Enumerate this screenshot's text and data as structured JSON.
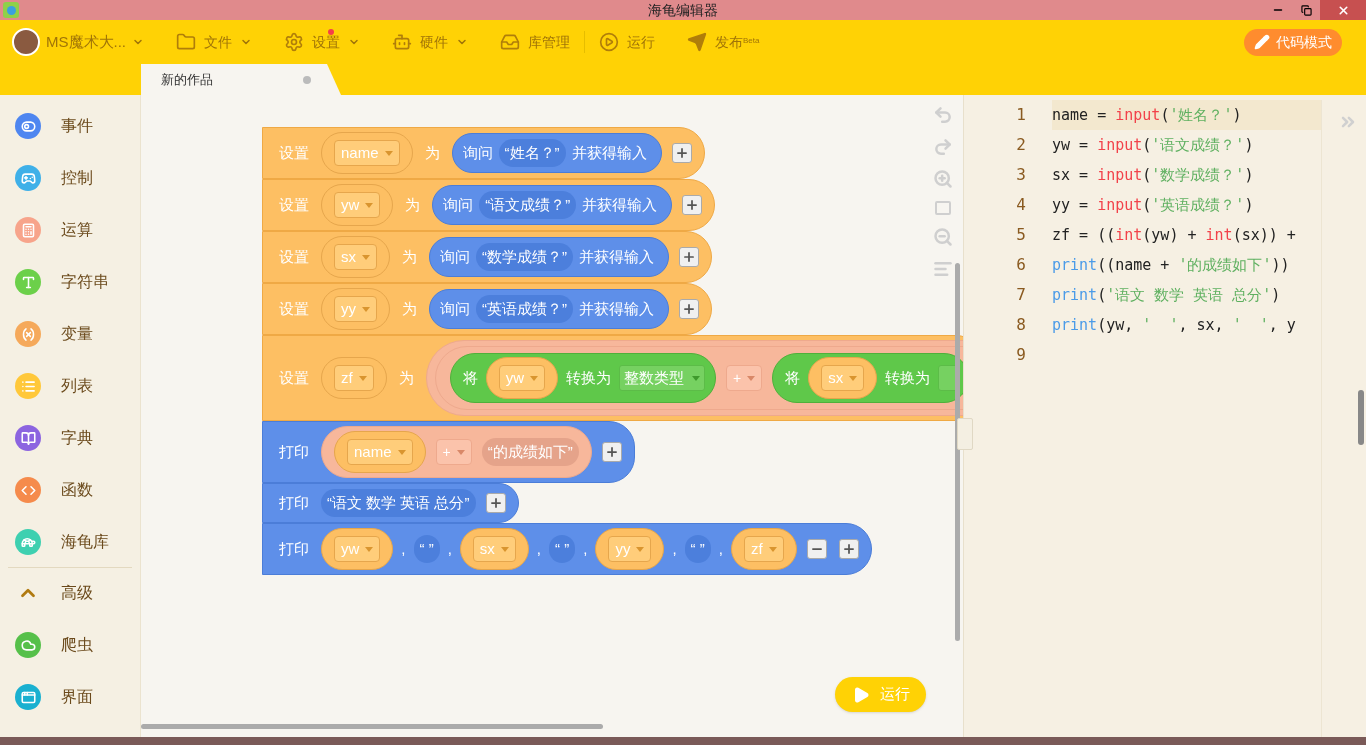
{
  "window": {
    "title": "海龟编辑器"
  },
  "toolbar": {
    "user": {
      "name": "MS魔术大..."
    },
    "menus": [
      {
        "label": "文件",
        "kind": "dropdown",
        "badge": false
      },
      {
        "label": "设置",
        "kind": "dropdown",
        "badge": true
      },
      {
        "label": "硬件",
        "kind": "dropdown",
        "badge": false
      },
      {
        "label": "库管理",
        "kind": "plain",
        "badge": false
      },
      {
        "label": "运行",
        "kind": "plain",
        "badge": false
      },
      {
        "label": "发布",
        "kind": "plain",
        "badge": false,
        "sup": "Beta"
      }
    ],
    "mode_button": "代码模式"
  },
  "tabs": [
    {
      "label": "新的作品",
      "selected": true
    }
  ],
  "sidebar": {
    "items": [
      {
        "label": "事件",
        "kind": "category",
        "color": "#4e86f0"
      },
      {
        "label": "控制",
        "kind": "category",
        "color": "#3fb0e8"
      },
      {
        "label": "运算",
        "kind": "category",
        "color": "#f7a48b"
      },
      {
        "label": "字符串",
        "kind": "category",
        "color": "#6cd04a"
      },
      {
        "label": "变量",
        "kind": "category",
        "color": "#f5a95b"
      },
      {
        "label": "列表",
        "kind": "category",
        "color": "#ffc83a"
      },
      {
        "label": "字典",
        "kind": "category",
        "color": "#8c64e0"
      },
      {
        "label": "函数",
        "kind": "category",
        "color": "#f58b4c"
      },
      {
        "label": "海龟库",
        "kind": "category",
        "color": "#3ed0b0"
      },
      {
        "label": "高级",
        "kind": "section",
        "color": "#b07a10"
      },
      {
        "label": "爬虫",
        "kind": "category",
        "color": "#56c04a"
      },
      {
        "label": "界面",
        "kind": "category",
        "color": "#1ab0d0"
      }
    ]
  },
  "blocks": [
    {
      "kind": "set",
      "parts": [
        {
          "kind": "label",
          "text": "设置"
        },
        {
          "kind": "var",
          "text": "name"
        },
        {
          "kind": "label",
          "text": "为"
        },
        {
          "kind": "ask",
          "label": "询问",
          "prompt": "“姓名？”",
          "suffix": "并获得输入"
        },
        {
          "kind": "plus"
        }
      ]
    },
    {
      "kind": "set",
      "parts": [
        {
          "kind": "label",
          "text": "设置"
        },
        {
          "kind": "var",
          "text": "yw"
        },
        {
          "kind": "label",
          "text": "为"
        },
        {
          "kind": "ask",
          "label": "询问",
          "prompt": "“语文成绩？”",
          "suffix": "并获得输入"
        },
        {
          "kind": "plus"
        }
      ]
    },
    {
      "kind": "set",
      "parts": [
        {
          "kind": "label",
          "text": "设置"
        },
        {
          "kind": "var",
          "text": "sx"
        },
        {
          "kind": "label",
          "text": "为"
        },
        {
          "kind": "ask",
          "label": "询问",
          "prompt": "“数学成绩？”",
          "suffix": "并获得输入"
        },
        {
          "kind": "plus"
        }
      ]
    },
    {
      "kind": "set",
      "parts": [
        {
          "kind": "label",
          "text": "设置"
        },
        {
          "kind": "var",
          "text": "yy"
        },
        {
          "kind": "label",
          "text": "为"
        },
        {
          "kind": "ask",
          "label": "询问",
          "prompt": "“英语成绩？”",
          "suffix": "并获得输入"
        },
        {
          "kind": "plus"
        }
      ]
    },
    {
      "kind": "set",
      "parts": [
        {
          "kind": "label",
          "text": "设置"
        },
        {
          "kind": "var",
          "text": "zf"
        },
        {
          "kind": "label",
          "text": "为"
        },
        {
          "kind": "expr",
          "nested": true,
          "parts": [
            {
              "kind": "convert",
              "label": "将",
              "var": "yw",
              "to": "转换为",
              "type": "整数类型"
            },
            {
              "kind": "op",
              "text": "+"
            },
            {
              "kind": "convert",
              "label": "将",
              "var": "sx",
              "to": "转换为"
            }
          ]
        }
      ]
    },
    {
      "kind": "print",
      "parts": [
        {
          "kind": "label",
          "text": "打印"
        },
        {
          "kind": "expr",
          "nested": false,
          "parts": [
            {
              "kind": "var",
              "text": "name"
            },
            {
              "kind": "op",
              "text": "+"
            },
            {
              "kind": "string",
              "text": "“的成绩如下”"
            }
          ]
        },
        {
          "kind": "plus"
        }
      ]
    },
    {
      "kind": "print",
      "parts": [
        {
          "kind": "label",
          "text": "打印"
        },
        {
          "kind": "string",
          "text": "“语文 数学 英语 总分”"
        },
        {
          "kind": "plus"
        }
      ]
    },
    {
      "kind": "print",
      "parts": [
        {
          "kind": "label",
          "text": "打印"
        },
        {
          "kind": "var",
          "text": "yw"
        },
        {
          "kind": "sep",
          "text": ","
        },
        {
          "kind": "string",
          "text": "“ ”"
        },
        {
          "kind": "sep",
          "text": ","
        },
        {
          "kind": "var",
          "text": "sx"
        },
        {
          "kind": "sep",
          "text": ","
        },
        {
          "kind": "string",
          "text": "“ ”"
        },
        {
          "kind": "sep",
          "text": ","
        },
        {
          "kind": "var",
          "text": "yy"
        },
        {
          "kind": "sep",
          "text": ","
        },
        {
          "kind": "string",
          "text": "“ ”"
        },
        {
          "kind": "sep",
          "text": ","
        },
        {
          "kind": "var",
          "text": "zf"
        },
        {
          "kind": "minus"
        },
        {
          "kind": "plus"
        }
      ]
    }
  ],
  "run_button": "运行",
  "code": {
    "lines": [
      {
        "number": "1",
        "highlighted": true,
        "tokens": [
          {
            "kind": "name",
            "text": "name = "
          },
          {
            "kind": "builtin",
            "text": "input"
          },
          {
            "kind": "name",
            "text": "("
          },
          {
            "kind": "string",
            "text": "'姓名？'"
          },
          {
            "kind": "name",
            "text": ")"
          }
        ]
      },
      {
        "number": "2",
        "highlighted": false,
        "tokens": [
          {
            "kind": "name",
            "text": "yw = "
          },
          {
            "kind": "builtin",
            "text": "input"
          },
          {
            "kind": "name",
            "text": "("
          },
          {
            "kind": "string",
            "text": "'语文成绩？'"
          },
          {
            "kind": "name",
            "text": ")"
          }
        ]
      },
      {
        "number": "3",
        "highlighted": false,
        "tokens": [
          {
            "kind": "name",
            "text": "sx = "
          },
          {
            "kind": "builtin",
            "text": "input"
          },
          {
            "kind": "name",
            "text": "("
          },
          {
            "kind": "string",
            "text": "'数学成绩？'"
          },
          {
            "kind": "name",
            "text": ")"
          }
        ]
      },
      {
        "number": "4",
        "highlighted": false,
        "tokens": [
          {
            "kind": "name",
            "text": "yy = "
          },
          {
            "kind": "builtin",
            "text": "input"
          },
          {
            "kind": "name",
            "text": "("
          },
          {
            "kind": "string",
            "text": "'英语成绩？'"
          },
          {
            "kind": "name",
            "text": ")"
          }
        ]
      },
      {
        "number": "5",
        "highlighted": false,
        "tokens": [
          {
            "kind": "name",
            "text": "zf = (("
          },
          {
            "kind": "builtin",
            "text": "int"
          },
          {
            "kind": "name",
            "text": "(yw) + "
          },
          {
            "kind": "builtin",
            "text": "int"
          },
          {
            "kind": "name",
            "text": "(sx)) +"
          }
        ]
      },
      {
        "number": "6",
        "highlighted": false,
        "tokens": [
          {
            "kind": "keyword",
            "text": "print"
          },
          {
            "kind": "name",
            "text": "((name + "
          },
          {
            "kind": "string",
            "text": "'的成绩如下'"
          },
          {
            "kind": "name",
            "text": "))"
          }
        ]
      },
      {
        "number": "7",
        "highlighted": false,
        "tokens": [
          {
            "kind": "keyword",
            "text": "print"
          },
          {
            "kind": "name",
            "text": "("
          },
          {
            "kind": "string",
            "text": "'语文 数学 英语 总分'"
          },
          {
            "kind": "name",
            "text": ")"
          }
        ]
      },
      {
        "number": "8",
        "highlighted": false,
        "tokens": [
          {
            "kind": "keyword",
            "text": "print"
          },
          {
            "kind": "name",
            "text": "(yw, "
          },
          {
            "kind": "string",
            "text": "'  '"
          },
          {
            "kind": "name",
            "text": ", sx, "
          },
          {
            "kind": "string",
            "text": "'  '"
          },
          {
            "kind": "name",
            "text": ", y"
          }
        ]
      },
      {
        "number": "9",
        "highlighted": false
      }
    ]
  }
}
